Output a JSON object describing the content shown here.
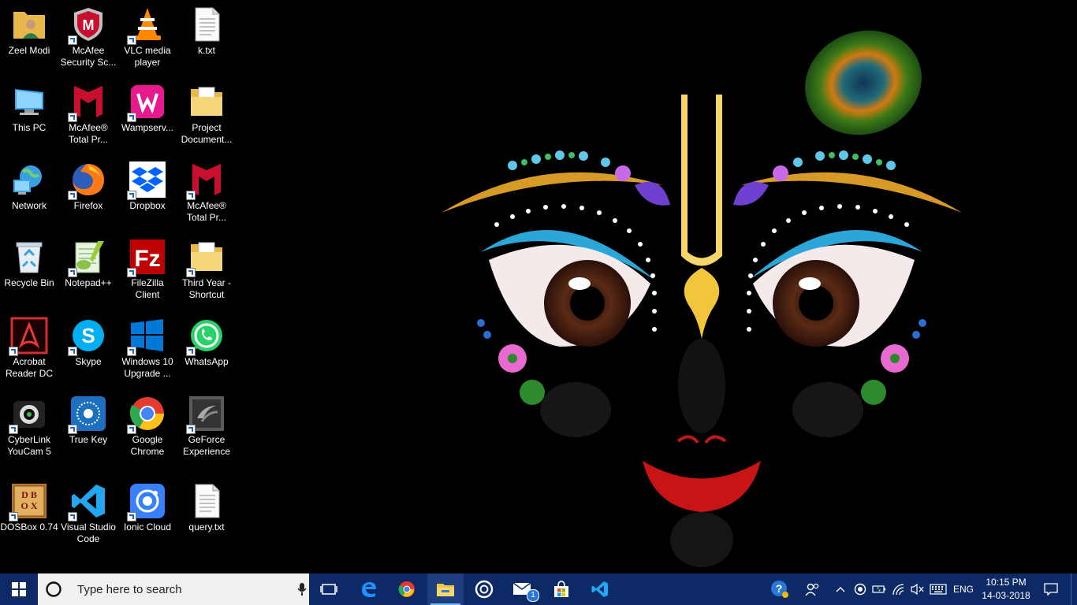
{
  "desktop": {
    "icons": [
      {
        "label": "Zeel Modi",
        "icon": "user-folder-icon"
      },
      {
        "label": "McAfee\nSecurity Sc...",
        "icon": "mcafee-shield-icon"
      },
      {
        "label": "VLC media\nplayer",
        "icon": "vlc-cone-icon"
      },
      {
        "label": "k.txt",
        "icon": "text-file-icon"
      },
      {
        "label": "This PC",
        "icon": "computer-icon"
      },
      {
        "label": "McAfee®\nTotal Pr...",
        "icon": "mcafee-icon"
      },
      {
        "label": "Wampserv...",
        "icon": "wampserver-icon"
      },
      {
        "label": "Project\nDocument...",
        "icon": "folder-icon"
      },
      {
        "label": "Network",
        "icon": "network-icon"
      },
      {
        "label": "Firefox",
        "icon": "firefox-icon"
      },
      {
        "label": "Dropbox",
        "icon": "dropbox-icon"
      },
      {
        "label": "McAfee®\nTotal Pr...",
        "icon": "mcafee-icon"
      },
      {
        "label": "Recycle Bin",
        "icon": "recycle-bin-icon"
      },
      {
        "label": "Notepad++",
        "icon": "notepad-plus-plus-icon"
      },
      {
        "label": "FileZilla\nClient",
        "icon": "filezilla-icon"
      },
      {
        "label": "Third Year -\nShortcut",
        "icon": "folder-icon"
      },
      {
        "label": "Acrobat\nReader DC",
        "icon": "acrobat-icon"
      },
      {
        "label": "Skype",
        "icon": "skype-icon"
      },
      {
        "label": "Windows 10\nUpgrade ...",
        "icon": "windows-upgrade-icon"
      },
      {
        "label": "WhatsApp",
        "icon": "whatsapp-icon"
      },
      {
        "label": "CyberLink\nYouCam 5",
        "icon": "webcam-icon"
      },
      {
        "label": "True Key",
        "icon": "truekey-icon"
      },
      {
        "label": "Google\nChrome",
        "icon": "chrome-icon"
      },
      {
        "label": "GeForce\nExperience",
        "icon": "geforce-icon"
      },
      {
        "label": "DOSBox 0.74",
        "icon": "dosbox-icon"
      },
      {
        "label": "Visual Studio\nCode",
        "icon": "vscode-icon"
      },
      {
        "label": "Ionic Cloud",
        "icon": "ionic-icon"
      },
      {
        "label": "query.txt",
        "icon": "text-file-icon"
      }
    ]
  },
  "taskbar": {
    "search_placeholder": "Type here to search",
    "pinned": [
      "task-view-icon",
      "edge-icon",
      "chrome-icon",
      "file-explorer-icon",
      "groove-icon",
      "mail-icon",
      "store-icon",
      "vscode-icon"
    ],
    "mail_badge": "1",
    "language": "ENG",
    "time": "10:15 PM",
    "date": "14-03-2018"
  },
  "colors": {
    "taskbar": "#0e2a66",
    "search_bg": "#f0f0f0",
    "desktop_bg": "#000000"
  }
}
